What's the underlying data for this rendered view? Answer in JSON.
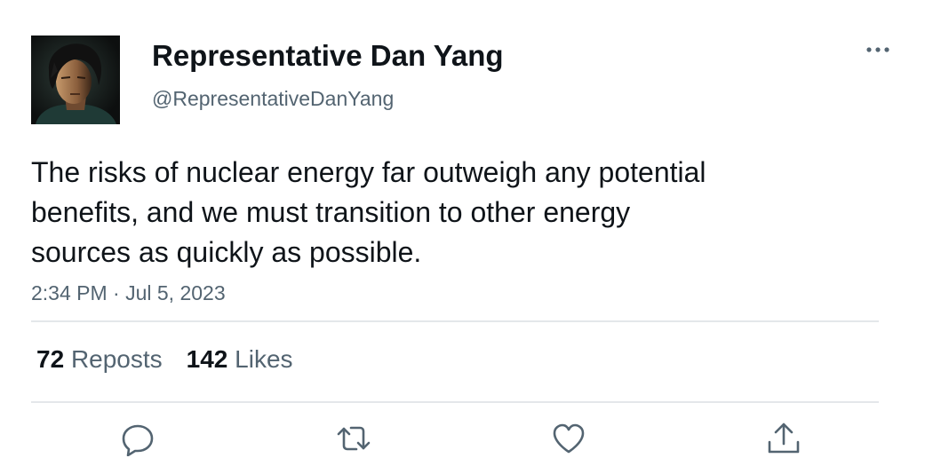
{
  "tweet": {
    "display_name": "Representative Dan Yang",
    "handle": "@RepresentativeDanYang",
    "more_icon": "more-horizontal-icon",
    "text_lines": [
      "The risks of nuclear energy far outweigh any potential",
      "benefits, and we must transition to other energy",
      "sources as quickly as possible."
    ],
    "timestamp": "2:34 PM · Jul 5, 2023"
  },
  "stats": {
    "reposts_count": "72",
    "reposts_label": "Reposts",
    "likes_count": "142",
    "likes_label": "Likes"
  },
  "actions": {
    "reply_icon": "reply-icon",
    "repost_icon": "repost-icon",
    "like_icon": "like-icon",
    "share_icon": "share-icon"
  },
  "colors": {
    "text_primary": "#0f1419",
    "text_secondary": "#536471",
    "divider": "#e4e7ea"
  }
}
